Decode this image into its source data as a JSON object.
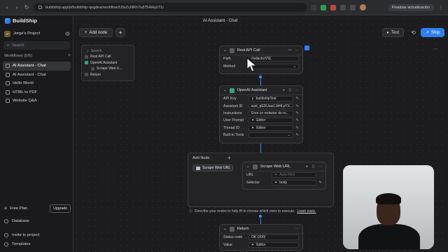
{
  "browser": {
    "url": "buildship.app/p/buildship-qegdea/workflow/U5xZuNRh7u8754HqUTU",
    "update_label": "Finalizar actualización"
  },
  "sidebar": {
    "logo": "BuildShip",
    "project_badge": "JP",
    "project_name": "Jorge's Project",
    "search_placeholder": "Search",
    "workflows_header": "Workflows (5/5)",
    "workflows": [
      {
        "label": "AI Assistant - Chat",
        "active": true
      },
      {
        "label": "AI Assistant - Chat",
        "active": false
      },
      {
        "label": "Hello World",
        "active": false
      },
      {
        "label": "HTML to PDF",
        "active": false
      },
      {
        "label": "Website Q&A",
        "active": false
      }
    ],
    "plan_label": "Free Plan",
    "upgrade_label": "Upgrade",
    "database_label": "Database",
    "invite_label": "Invite to project",
    "templates_label": "Templates"
  },
  "toolbar": {
    "title": "AI Assistant - Chat",
    "add_node": "Add node",
    "test": "Test",
    "ship": "Ship"
  },
  "outline": {
    "search": "Search",
    "items": [
      "Rest API Call",
      "OpenAI Assistant",
      "Scrape Web U...",
      "Return"
    ]
  },
  "rest_node": {
    "title": "Rest API Call",
    "rows": [
      {
        "label": "Path",
        "value": "/redactorVSL"
      },
      {
        "label": "Method",
        "value": ""
      }
    ]
  },
  "openai_node": {
    "title": "OpenAI Assistant",
    "rows": [
      {
        "label": "API Key",
        "value": "buildshipTest"
      },
      {
        "label": "Assistant ID",
        "value": "asst_qEDUaw1JdHLpTX..."
      },
      {
        "label": "Instructions",
        "value": "Eres un redactor de re..."
      },
      {
        "label": "User Prompt",
        "value": "Editor"
      },
      {
        "label": "Thread ID",
        "value": "Editor"
      },
      {
        "label": "Built-in Tools",
        "value": ""
      }
    ]
  },
  "addnode_panel": {
    "title": "Add Node",
    "chip": "Scrape Web URL"
  },
  "scrape_node": {
    "title": "Scrape Web URL",
    "rows": [
      {
        "label": "URL",
        "value": "Auto-filled"
      },
      {
        "label": "Selector",
        "value": "body"
      }
    ]
  },
  "hint": {
    "text": "Describe your nodes to help AI to choose which ones to execute.",
    "link": "Learn more."
  },
  "return_node": {
    "title": "Return",
    "rows": [
      {
        "label": "Status code",
        "value": "OK (200)"
      },
      {
        "label": "Value",
        "value": "Editor"
      }
    ]
  }
}
